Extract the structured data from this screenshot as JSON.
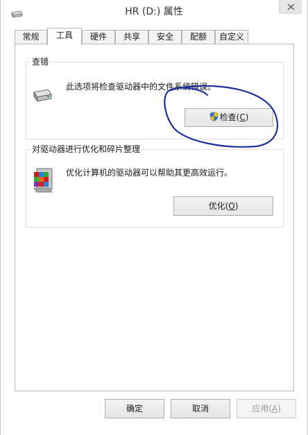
{
  "window": {
    "title": "HR (D:) 属性"
  },
  "tabs": [
    {
      "label": "常规"
    },
    {
      "label": "工具"
    },
    {
      "label": "硬件"
    },
    {
      "label": "共享"
    },
    {
      "label": "安全"
    },
    {
      "label": "配额"
    },
    {
      "label": "自定义"
    }
  ],
  "error_check": {
    "title": "查错",
    "description": "此选项将检查驱动器中的文件系统错误。",
    "button": {
      "text": "检查",
      "mnemonic": "C"
    }
  },
  "optimize": {
    "title": "对驱动器进行优化和碎片整理",
    "description": "优化计算机的驱动器可以帮助其更高效运行。",
    "button": {
      "text": "优化",
      "mnemonic": "O"
    }
  },
  "footer": {
    "ok": "确定",
    "cancel": "取消",
    "apply": {
      "text": "应用",
      "mnemonic": "A"
    }
  },
  "icons": {
    "title": "drive-icon",
    "error_check": "hard-drive-icon",
    "optimize": "defrag-icon",
    "check_button": "uac-shield-icon"
  },
  "colors": {
    "annotation": "#1c2f9e"
  }
}
